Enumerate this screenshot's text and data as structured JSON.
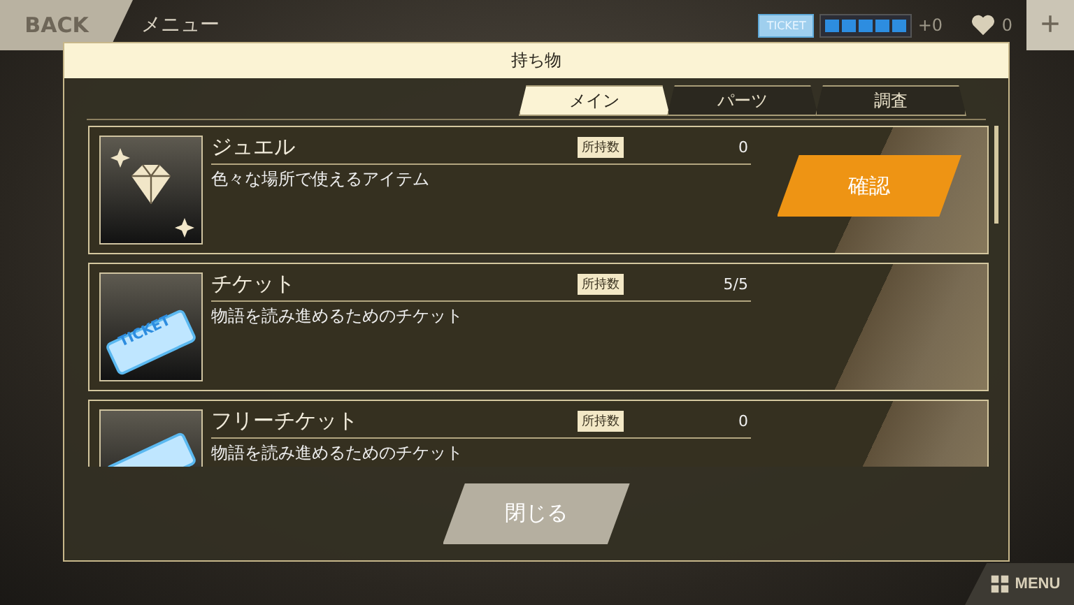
{
  "top_bar": {
    "back": "BACK",
    "title": "メニュー",
    "ticket_badge": "TICKET",
    "ticket_pips": [
      {
        "on": true
      },
      {
        "on": true
      },
      {
        "on": true
      },
      {
        "on": true
      },
      {
        "on": true
      }
    ],
    "ticket_bonus": "+0",
    "hearts": "0",
    "add": "+"
  },
  "dialog": {
    "title": "持ち物",
    "tabs": [
      {
        "label": "メイン",
        "selected": true
      },
      {
        "label": "パーツ",
        "selected": false
      },
      {
        "label": "調査",
        "selected": false
      }
    ],
    "items": [
      {
        "kind": "jewel",
        "name": "ジュエル",
        "badge": "所持数",
        "count": "0",
        "description": "色々な場所で使えるアイテム",
        "action": "確認"
      },
      {
        "kind": "ticket",
        "name": "チケット",
        "badge": "所持数",
        "count": "5/5",
        "description": "物語を読み進めるためのチケット",
        "icon_label": "TICKET"
      },
      {
        "kind": "free_ticket",
        "name": "フリーチケット",
        "badge": "所持数",
        "count": "0",
        "description": "物語を読み進めるためのチケット"
      }
    ],
    "close": "閉じる"
  },
  "menu_button": "MENU"
}
